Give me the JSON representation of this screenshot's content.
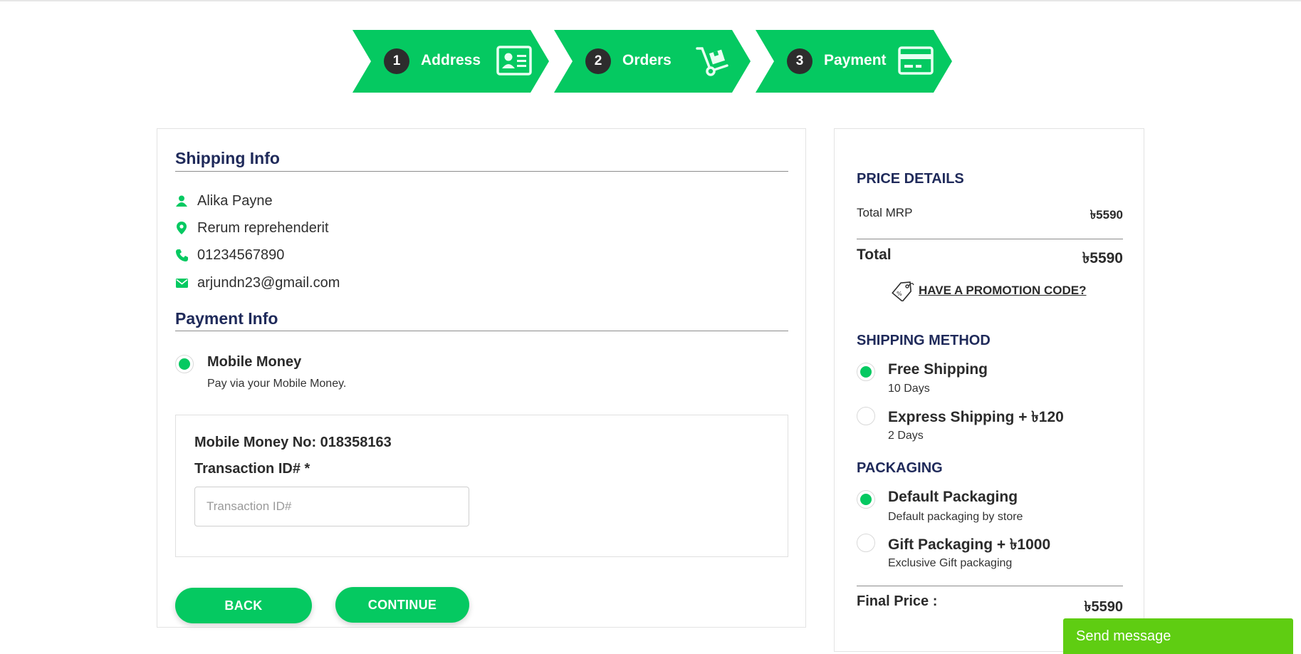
{
  "steps": [
    {
      "num": "1",
      "label": "Address",
      "icon": "contact-card-icon"
    },
    {
      "num": "2",
      "label": "Orders",
      "icon": "hand-truck-icon"
    },
    {
      "num": "3",
      "label": "Payment",
      "icon": "credit-card-icon"
    }
  ],
  "shipping_info": {
    "title": "Shipping Info",
    "name": "Alika Payne",
    "address": "Rerum reprehenderit",
    "phone": "01234567890",
    "email": "arjundn23@gmail.com"
  },
  "payment_info": {
    "title": "Payment Info",
    "method_title": "Mobile Money",
    "method_sub": "Pay via your Mobile Money.",
    "mobile_no": "Mobile Money No: 018358163",
    "tx_label": "Transaction ID# *",
    "tx_placeholder": "Transaction ID#",
    "tx_value": ""
  },
  "buttons": {
    "back": "BACK",
    "continue": "CONTINUE"
  },
  "price_details": {
    "title": "PRICE DETAILS",
    "mrp_label": "Total MRP",
    "mrp_value": "৳5590",
    "total_label": "Total",
    "total_value": "৳5590",
    "promo": "HAVE A PROMOTION CODE?"
  },
  "shipping_method": {
    "title": "SHIPPING METHOD",
    "options": [
      {
        "title": "Free Shipping",
        "sub": "10 Days",
        "selected": true
      },
      {
        "title": "Express Shipping + ৳120",
        "sub": "2 Days",
        "selected": false
      }
    ]
  },
  "packaging": {
    "title": "PACKAGING",
    "options": [
      {
        "title": "Default Packaging",
        "sub": "Default packaging by store",
        "selected": true
      },
      {
        "title": "Gift Packaging + ৳1000",
        "sub": "Exclusive Gift packaging",
        "selected": false
      }
    ]
  },
  "final_price": {
    "label": "Final Price :",
    "value": "৳5590"
  },
  "chat": {
    "label": "Send message"
  },
  "colors": {
    "accent": "#05c961",
    "heading": "#1f2a5a",
    "step_badge": "#2d2d2d",
    "chat": "#5fcd12"
  }
}
